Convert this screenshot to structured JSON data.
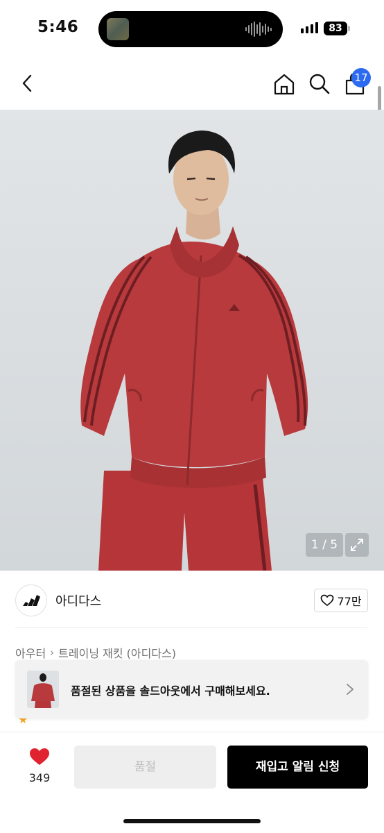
{
  "status_bar": {
    "time": "5:46",
    "battery": "83"
  },
  "nav": {
    "cart_count": "17"
  },
  "image": {
    "counter": "1 / 5"
  },
  "brand": {
    "name": "아디다스",
    "likes": "77만"
  },
  "breadcrumb": {
    "category": "아우터",
    "subcategory": "트레이닝 재킷 (아디다스)"
  },
  "banner": {
    "text": "품절된 상품을 솔드아웃에서 구매해보세요."
  },
  "bottom_bar": {
    "wish_count": "349",
    "soldout_label": "품절",
    "restock_label": "재입고 알림 신청"
  },
  "colors": {
    "accent_blue": "#2c6bf0",
    "heart_red": "#e0242f",
    "jacket_red": "#b83a3d"
  },
  "icons": [
    "back-icon",
    "home-icon",
    "search-icon",
    "cart-icon",
    "expand-icon",
    "heart-outline-icon",
    "chevron-right-icon",
    "heart-filled-icon"
  ]
}
